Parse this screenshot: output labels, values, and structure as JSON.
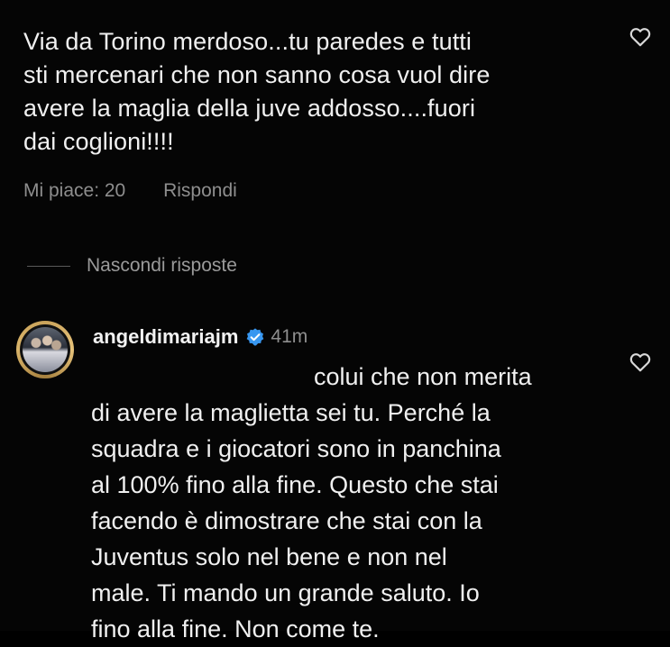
{
  "comment": {
    "lines": [
      "Via da Torino merdoso...tu paredes e tutti",
      "sti mercenari che non sanno cosa vuol dire",
      "avere la maglia della juve addosso....fuori",
      "dai coglioni!!!!"
    ],
    "likes_label": "Mi piace: 20",
    "reply_label": "Rispondi"
  },
  "hide_replies_label": "Nascondi risposte",
  "reply": {
    "username": "angeldimariajm",
    "time": "41m",
    "lines": [
      "colui che non merita",
      "di avere la maglietta sei tu. Perché la",
      "squadra e i giocatori sono in panchina",
      "al 100% fino alla fine. Questo che stai",
      "facendo è dimostrare che stai con la",
      "Juventus solo nel bene e non nel",
      "male. Ti mando un grande saluto. Io",
      "fino alla fine. Non come te."
    ]
  },
  "icons": {
    "like": "heart-icon",
    "verified": "verified-badge-icon"
  },
  "colors": {
    "background": "#050505",
    "text": "#f0f0f0",
    "muted": "#8e8e8e",
    "verified_blue": "#3897f0"
  }
}
